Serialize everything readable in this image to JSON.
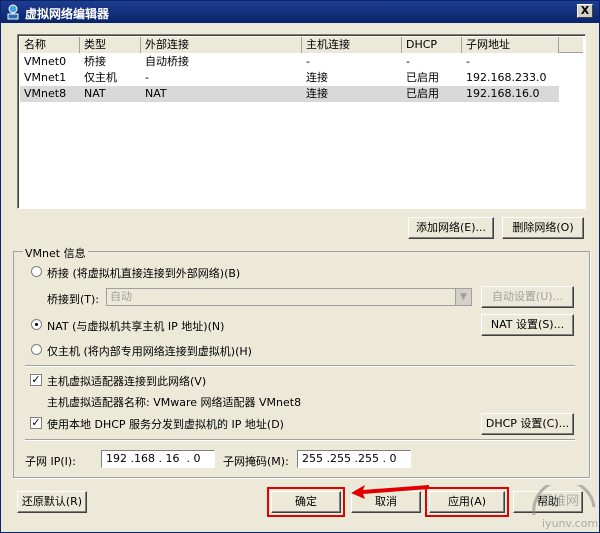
{
  "window": {
    "title": "虚拟网络编辑器",
    "close_label": "X"
  },
  "networks": {
    "columns": [
      "名称",
      "类型",
      "外部连接",
      "主机连接",
      "DHCP",
      "子网地址"
    ],
    "rows": [
      [
        "VMnet0",
        "桥接",
        "自动桥接",
        "-",
        "-",
        "-"
      ],
      [
        "VMnet1",
        "仅主机",
        "-",
        "连接",
        "已启用",
        "192.168.233.0"
      ],
      [
        "VMnet8",
        "NAT",
        "NAT",
        "连接",
        "已启用",
        "192.168.16.0"
      ]
    ],
    "selected_row": 2
  },
  "buttons": {
    "add_network": "添加网络(E)...",
    "remove_network": "删除网络(O)",
    "auto_settings": "自动设置(U)...",
    "nat_settings": "NAT 设置(S)...",
    "dhcp_settings": "DHCP 设置(C)...",
    "restore_defaults": "还原默认(R)",
    "ok": "确定",
    "cancel": "取消",
    "apply": "应用(A)",
    "help": "帮助"
  },
  "vmnet_info": {
    "legend": "VMnet 信息",
    "bridged_label": "桥接 (将虚拟机直接连接到外部网络)(B)",
    "bridged_to_label": "桥接到(T):",
    "bridged_to_value": "自动",
    "nat_label": "NAT (与虚拟机共享主机 IP 地址)(N)",
    "hostonly_label": "仅主机 (将内部专用网络连接到虚拟机)(H)",
    "selected_mode": "NAT",
    "connect_adapter_label": "主机虚拟适配器连接到此网络(V)",
    "connect_adapter_checked": true,
    "adapter_name_text": "主机虚拟适配器名称: VMware 网络适配器 VMnet8",
    "dhcp_label": "使用本地 DHCP 服务分发到虚拟机的 IP 地址(D)",
    "dhcp_checked": true,
    "subnet_ip_label": "子网 IP(I):",
    "subnet_ip_value": "192 .168 . 16  . 0",
    "subnet_mask_label": "子网掩码(M):",
    "subnet_mask_value": "255 .255 .255 . 0"
  },
  "watermark": {
    "top": "互维网",
    "bottom": "iyunv.com"
  },
  "colors": {
    "title_bar": "#0a246a",
    "annotation_red": "#e00000",
    "window_bg": "#ece9d8"
  }
}
